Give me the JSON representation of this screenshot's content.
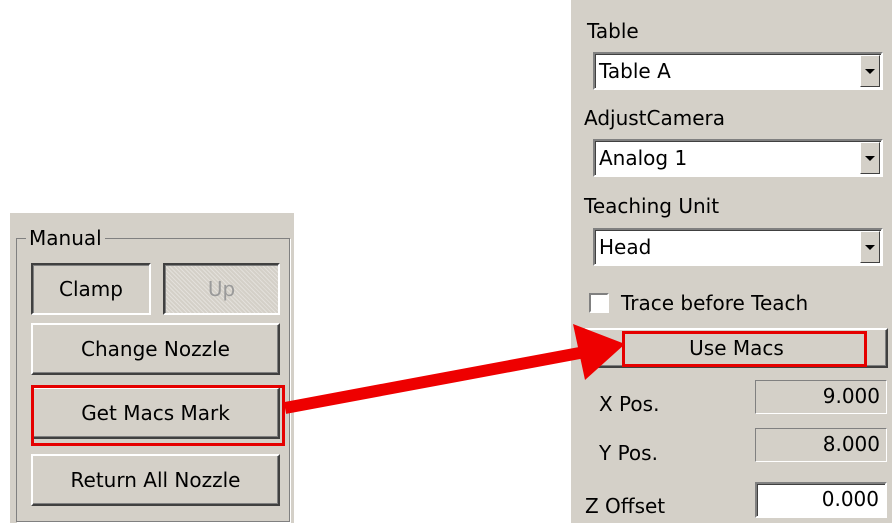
{
  "manual": {
    "group_title": "Manual",
    "clamp_label": "Clamp",
    "up_label": "Up",
    "change_nozzle_label": "Change Nozzle",
    "get_macs_mark_label": "Get Macs Mark",
    "return_all_nozzle_label": "Return All Nozzle"
  },
  "settings": {
    "table_label": "Table",
    "table_value": "Table A",
    "adjust_camera_label": "AdjustCamera",
    "adjust_camera_value": "Analog 1",
    "teaching_unit_label": "Teaching Unit",
    "teaching_unit_value": "Head",
    "trace_before_teach_label": "Trace before Teach",
    "trace_before_teach_checked": false,
    "use_macs_label": "Use Macs",
    "x_pos_label": "X Pos.",
    "x_pos_value": "9.000",
    "y_pos_label": "Y Pos.",
    "y_pos_value": "8.000",
    "z_offset_label": "Z Offset",
    "z_offset_value": "0.000"
  },
  "annotation": {
    "highlight_color": "#e50000",
    "arrow_color": "#ee0000"
  },
  "colors": {
    "panel_bg": "#d4d0c8"
  }
}
